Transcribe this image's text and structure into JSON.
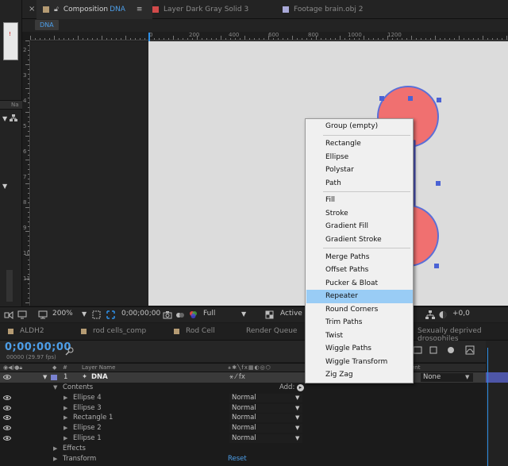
{
  "comp_tabs": [
    {
      "prefix": "Composition",
      "name": "DNA",
      "color": "#b59b73",
      "active": true
    },
    {
      "prefix": "Layer",
      "name": "Dark Gray Solid 3",
      "color": "#d14a4a",
      "active": false
    },
    {
      "prefix": "Footage",
      "name": "brain.obj 2",
      "color": "#a9a9d8",
      "active": false
    }
  ],
  "viewer_chip": "DNA",
  "ruler": {
    "top": [
      "0",
      "200",
      "400",
      "600",
      "800",
      "1000",
      "1200"
    ],
    "left": [
      "2",
      "3",
      "4",
      "5",
      "6",
      "7",
      "8",
      "9",
      "10",
      "11"
    ]
  },
  "viewer_footer": {
    "zoom": "200%",
    "timecode": "0;00;00;00",
    "resolution": "Full",
    "camera": "Active C",
    "exposure": "+0,0"
  },
  "timeline_tabs": [
    {
      "label": "ALDH2",
      "color": "#b59b73"
    },
    {
      "label": "rod cells_comp",
      "color": "#b59b73"
    },
    {
      "label": "Rod Cell",
      "color": "#b59b73"
    },
    {
      "label": "Render Queue",
      "color": ""
    },
    {
      "label": "Sexually deprived drosophiles",
      "color": ""
    }
  ],
  "timeline": {
    "timecode": "0;00;00;00",
    "fps": "00000 (29.97 fps)",
    "col_hash": "#",
    "col_layer_name": "Layer Name",
    "col_parent": "ent",
    "layer": {
      "index": "1",
      "name": "DNA",
      "parent": "None"
    },
    "contents_label": "Contents",
    "add_label": "Add:",
    "groups": [
      {
        "name": "Ellipse 4",
        "mode": "Normal"
      },
      {
        "name": "Ellipse 3",
        "mode": "Normal"
      },
      {
        "name": "Rectangle 1",
        "mode": "Normal"
      },
      {
        "name": "Ellipse 2",
        "mode": "Normal"
      },
      {
        "name": "Ellipse 1",
        "mode": "Normal"
      }
    ],
    "effects_label": "Effects",
    "transform_label": "Transform",
    "reset_label": "Reset"
  },
  "context_menu": {
    "items": [
      {
        "label": "Group (empty)",
        "highlighted": false
      },
      {
        "label": "Rectangle",
        "highlighted": false
      },
      {
        "label": "Ellipse",
        "highlighted": false
      },
      {
        "label": "Polystar",
        "highlighted": false
      },
      {
        "label": "Path",
        "highlighted": false
      },
      {
        "label": "Fill",
        "highlighted": false
      },
      {
        "label": "Stroke",
        "highlighted": false
      },
      {
        "label": "Gradient Fill",
        "highlighted": false
      },
      {
        "label": "Gradient Stroke",
        "highlighted": false
      },
      {
        "label": "Merge Paths",
        "highlighted": false
      },
      {
        "label": "Offset Paths",
        "highlighted": false
      },
      {
        "label": "Pucker & Bloat",
        "highlighted": false
      },
      {
        "label": "Repeater",
        "highlighted": true
      },
      {
        "label": "Round Corners",
        "highlighted": false
      },
      {
        "label": "Trim Paths",
        "highlighted": false
      },
      {
        "label": "Twist",
        "highlighted": false
      },
      {
        "label": "Wiggle Paths",
        "highlighted": false
      },
      {
        "label": "Wiggle Transform",
        "highlighted": false
      },
      {
        "label": "Zig Zag",
        "highlighted": false
      }
    ]
  },
  "colors": {
    "accent_blue": "#2e8fe6",
    "menu_highlight": "#99ccf5",
    "shape_fill": "#f07070",
    "shape_stroke": "#5a6fd8",
    "track_color": "#4e56a8"
  }
}
